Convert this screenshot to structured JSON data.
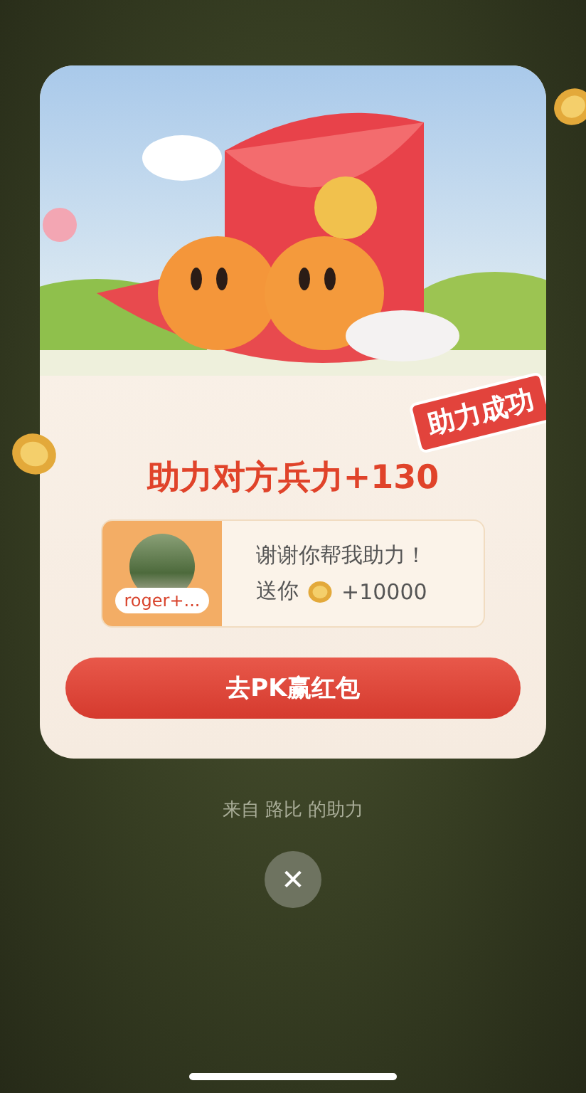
{
  "stamp": "助力成功",
  "title": "助力对方兵力+130",
  "helper": {
    "name": "roger+...",
    "message": "谢谢你帮我助力！",
    "gift_prefix": "送你",
    "gift_amount": "+10000"
  },
  "button": "去PK赢红包",
  "footer": "来自 路比 的助力",
  "close": "✕"
}
